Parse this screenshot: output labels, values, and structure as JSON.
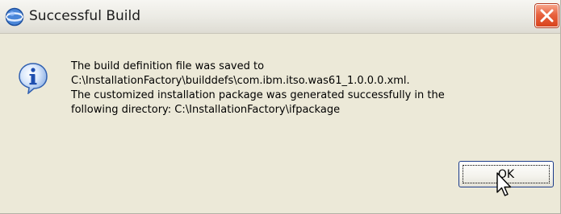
{
  "dialog": {
    "title": "Successful Build",
    "title_icon": "websphere-globe-icon",
    "close_icon": "close-x-icon",
    "message_icon": "information-icon",
    "message_lines": [
      "The build definition file was saved to",
      "C:\\InstallationFactory\\builddefs\\com.ibm.itso.was61_1.0.0.0.xml.",
      "The customized installation package was generated successfully in the",
      "following directory: C:\\InstallationFactory\\ifpackage"
    ],
    "ok_label": "OK"
  },
  "cursor": {
    "icon": "mouse-pointer-icon"
  },
  "colors": {
    "dialog_background": "#ece9d8",
    "close_button": "#e8623f",
    "button_border": "#1b3b8a",
    "info_icon": "#2f6fd6"
  }
}
